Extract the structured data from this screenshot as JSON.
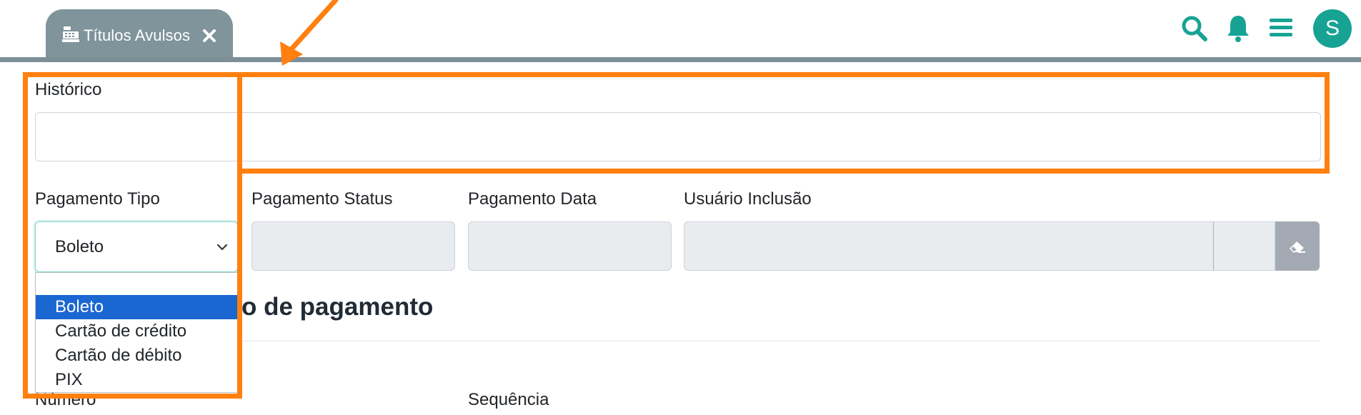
{
  "header": {
    "tab_label": "Títulos Avulsos",
    "avatar_initial": "S",
    "icons": [
      "cash-register-icon",
      "close-icon",
      "search-icon",
      "bell-icon",
      "menu-icon"
    ]
  },
  "form": {
    "historico_label": "Histórico",
    "historico_value": "",
    "pagamento_tipo_label": "Pagamento Tipo",
    "pagamento_tipo_value": "Boleto",
    "pagamento_status_label": "Pagamento Status",
    "pagamento_data_label": "Pagamento Data",
    "usuario_inclusao_label": "Usuário Inclusão"
  },
  "dropdown": {
    "options": [
      "Boleto",
      "Cartão de crédito",
      "Cartão de débito",
      "PIX"
    ],
    "selected": "Boleto"
  },
  "section": {
    "title_partial": "o de pagamento",
    "numero_label": "Número",
    "sequencia_label": "Sequência"
  },
  "colors": {
    "tab_bg": "#7f949b",
    "accent": "#17a394",
    "highlight": "#ff7f0f",
    "option_selected": "#1a67d2"
  }
}
